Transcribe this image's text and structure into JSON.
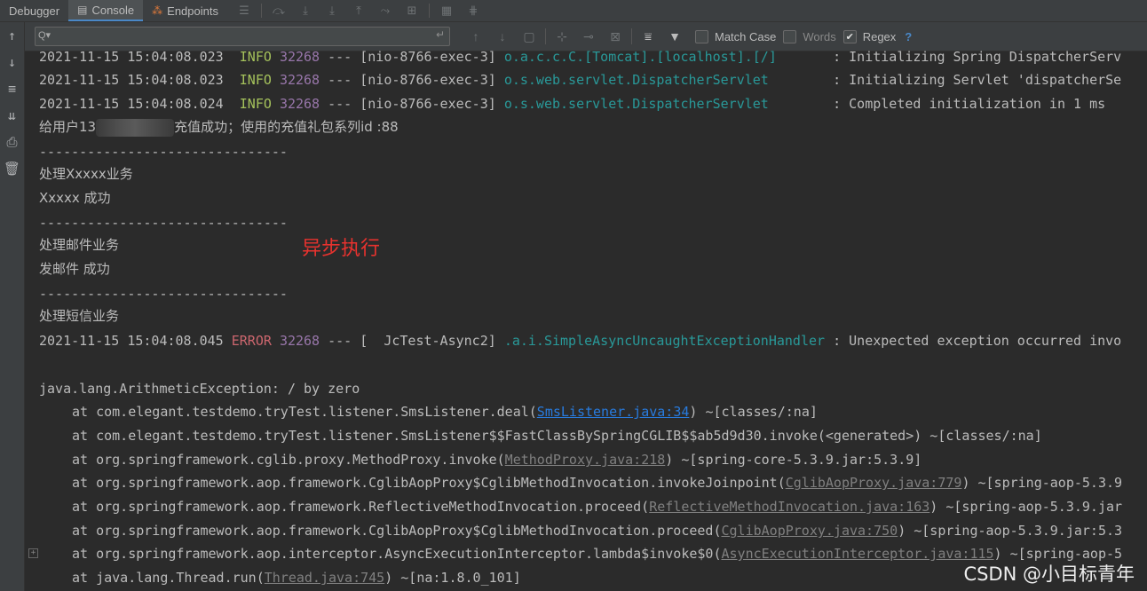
{
  "tabs": [
    {
      "label": "Debugger",
      "icon": ""
    },
    {
      "label": "Console",
      "icon": "console-icon"
    },
    {
      "label": "Endpoints",
      "icon": "endpoints-icon"
    }
  ],
  "toolbar_icons": [
    "menu-icon",
    "step-over-icon",
    "step-into-icon",
    "force-step-into-icon",
    "step-out-icon",
    "run-to-cursor-icon",
    "evaluate-icon",
    "table-icon",
    "threads-icon"
  ],
  "search": {
    "value": "",
    "placeholder": "",
    "options": [
      {
        "label": "Match Case",
        "checked": false
      },
      {
        "label": "Words",
        "checked": false
      },
      {
        "label": "Regex",
        "checked": true
      }
    ],
    "help": "?"
  },
  "log": {
    "info_lines": [
      {
        "ts": "2021-11-15 15:04:08.023",
        "level": "INFO",
        "pid": "32268",
        "sep": "---",
        "thread": "[nio-8766-exec-3]",
        "logger": "o.a.c.c.C.[Tomcat].[localhost].[/]",
        "msg": ": Initializing Spring DispatcherServ"
      },
      {
        "ts": "2021-11-15 15:04:08.023",
        "level": "INFO",
        "pid": "32268",
        "sep": "---",
        "thread": "[nio-8766-exec-3]",
        "logger": "o.s.web.servlet.DispatcherServlet",
        "msg": ": Initializing Servlet 'dispatcherSe"
      },
      {
        "ts": "2021-11-15 15:04:08.024",
        "level": "INFO",
        "pid": "32268",
        "sep": "---",
        "thread": "[nio-8766-exec-3]",
        "logger": "o.s.web.servlet.DispatcherServlet",
        "msg": ": Completed initialization in 1 ms"
      }
    ],
    "recharge_prefix": "给用户13",
    "recharge_suffix": "充值成功；使用的充值礼包系列id :88",
    "divider": "-------------------------------",
    "biz1_title": "处理Xxxxx业务",
    "biz1_result": "Xxxxx 成功",
    "biz2_title": "处理邮件业务",
    "biz2_result": "发邮件 成功",
    "biz3_title": "处理短信业务",
    "error_line": {
      "ts": "2021-11-15 15:04:08.045",
      "level": "ERROR",
      "pid": "32268",
      "sep": "--- [",
      "thread": "JcTest-Async2]",
      "logger": ".a.i.SimpleAsyncUncaughtExceptionHandler",
      "msg": ": Unexpected exception occurred invo"
    },
    "exception": "java.lang.ArithmeticException: / by zero",
    "stack": [
      {
        "pre": "at com.elegant.testdemo.tryTest.listener.SmsListener.deal(",
        "link": "SmsListener.java:34",
        "post": ") ~[classes/:na]",
        "grey": false
      },
      {
        "pre": "at com.elegant.testdemo.tryTest.listener.SmsListener$$FastClassBySpringCGLIB$$ab5d9d30.invoke(<generated>) ~[classes/:na]",
        "link": "",
        "post": "",
        "grey": false
      },
      {
        "pre": "at org.springframework.cglib.proxy.MethodProxy.invoke(",
        "link": "MethodProxy.java:218",
        "post": ") ~[spring-core-5.3.9.jar:5.3.9]",
        "grey": true
      },
      {
        "pre": "at org.springframework.aop.framework.CglibAopProxy$CglibMethodInvocation.invokeJoinpoint(",
        "link": "CglibAopProxy.java:779",
        "post": ") ~[spring-aop-5.3.9",
        "grey": true
      },
      {
        "pre": "at org.springframework.aop.framework.ReflectiveMethodInvocation.proceed(",
        "link": "ReflectiveMethodInvocation.java:163",
        "post": ") ~[spring-aop-5.3.9.jar",
        "grey": true
      },
      {
        "pre": "at org.springframework.aop.framework.CglibAopProxy$CglibMethodInvocation.proceed(",
        "link": "CglibAopProxy.java:750",
        "post": ") ~[spring-aop-5.3.9.jar:5.3",
        "grey": true
      },
      {
        "pre": "at org.springframework.aop.interceptor.AsyncExecutionInterceptor.lambda$invoke$0(",
        "link": "AsyncExecutionInterceptor.java:115",
        "post": ") ~[spring-aop-5",
        "grey": true
      },
      {
        "pre": "at java.lang.Thread.run(",
        "link": "Thread.java:745",
        "post": ") ~[na:1.8.0_101]",
        "grey": true
      }
    ]
  },
  "annotation": "异步执行",
  "watermark": "CSDN @小目标青年",
  "colors": {
    "info": "#a5c25c",
    "error": "#cc666e",
    "pid": "#9876aa",
    "logger": "#299999",
    "link": "#287bde",
    "annotation": "#e8322e"
  }
}
